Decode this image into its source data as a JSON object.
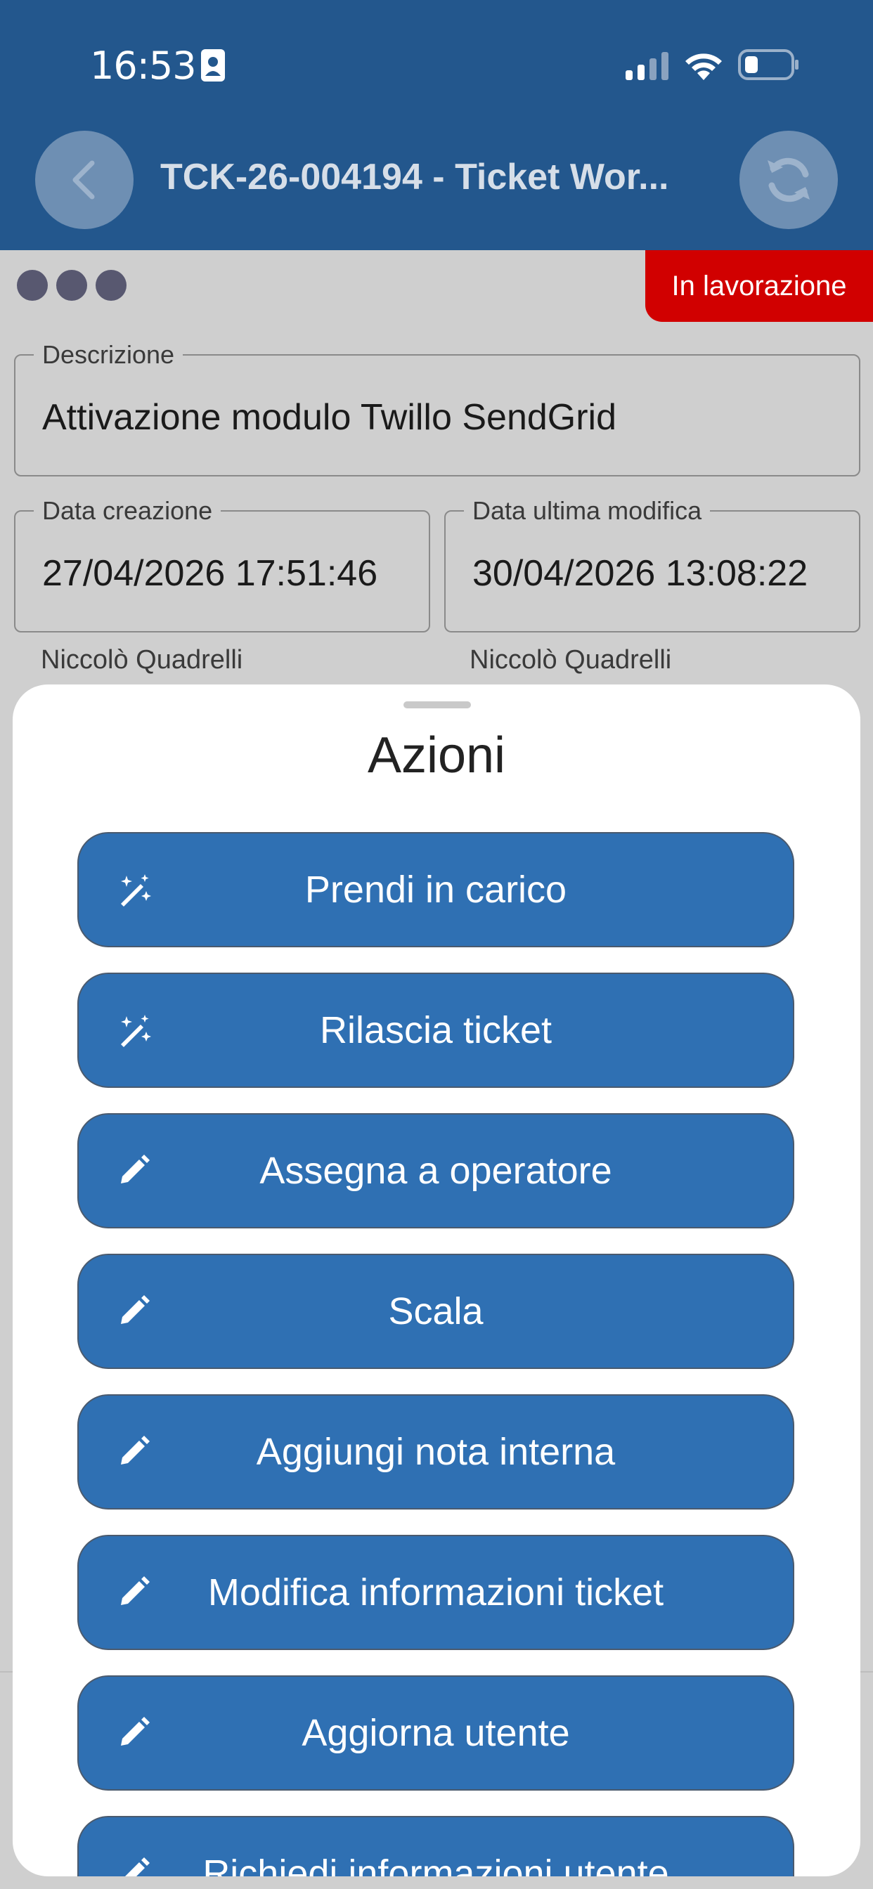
{
  "status_bar": {
    "time": "16:53"
  },
  "header": {
    "title": "TCK-26-004194 - Ticket Wor..."
  },
  "ticket": {
    "status": "In lavorazione",
    "description_label": "Descrizione",
    "description_value": "Attivazione modulo Twillo SendGrid",
    "created_label": "Data creazione",
    "created_value": "27/04/2026 17:51:46",
    "created_by": "Niccolò Quadrelli",
    "modified_label": "Data ultima modifica",
    "modified_value": "30/04/2026 13:08:22",
    "modified_by": "Niccolò Quadrelli"
  },
  "sheet": {
    "title": "Azioni",
    "actions": [
      {
        "label": "Prendi in carico",
        "icon": "magic-wand-icon"
      },
      {
        "label": "Rilascia ticket",
        "icon": "magic-wand-icon"
      },
      {
        "label": "Assegna a operatore",
        "icon": "pencil-icon"
      },
      {
        "label": "Scala",
        "icon": "pencil-icon"
      },
      {
        "label": "Aggiungi nota interna",
        "icon": "pencil-icon"
      },
      {
        "label": "Modifica informazioni ticket",
        "icon": "pencil-icon"
      },
      {
        "label": "Aggiorna utente",
        "icon": "pencil-icon"
      },
      {
        "label": "Richiedi informazioni utente",
        "icon": "pencil-icon"
      }
    ]
  },
  "colors": {
    "header": "#23578d",
    "badge": "#d10000",
    "button": "#2f70b3"
  }
}
